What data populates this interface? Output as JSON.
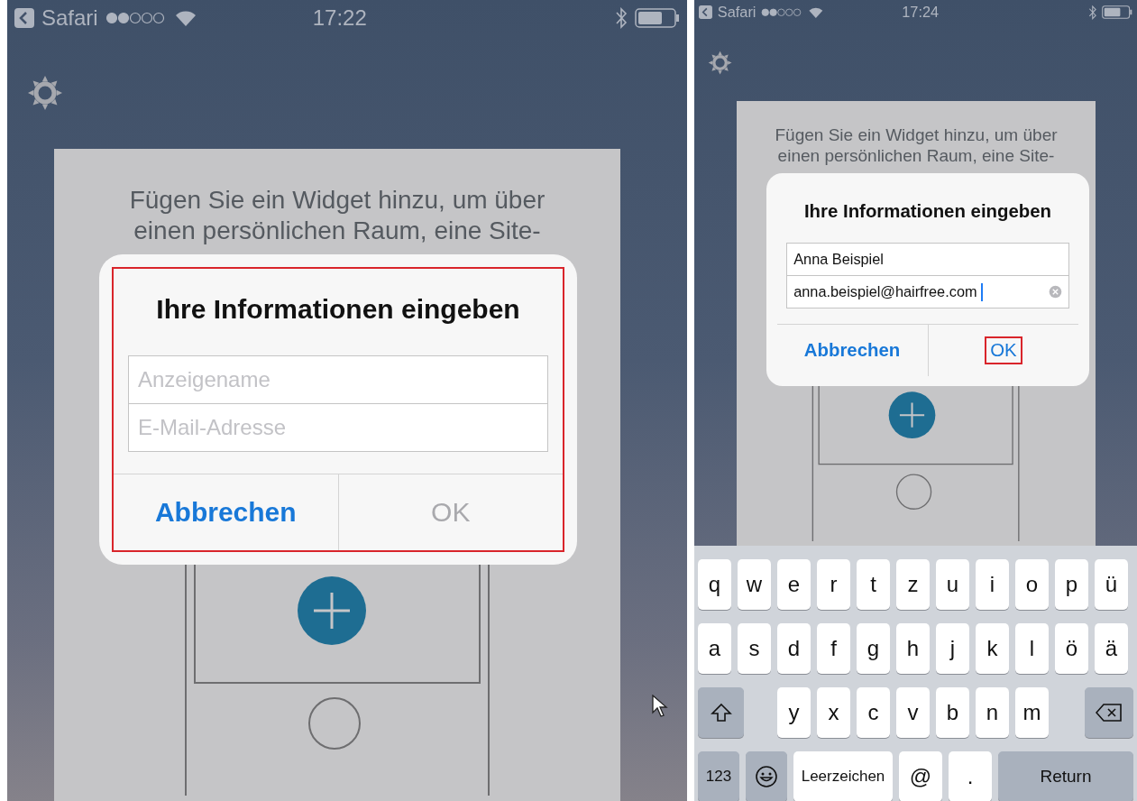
{
  "screens": [
    {
      "status_bar": {
        "back_label": "Safari",
        "time": "17:22"
      },
      "card_text_lines": [
        "Fügen Sie ein Widget hinzu, um über",
        "einen persönlichen Raum, eine Site-"
      ],
      "dialog": {
        "title": "Ihre Informationen eingeben",
        "highlighted": true,
        "fields": [
          {
            "placeholder": "Anzeigename",
            "focused": false
          },
          {
            "placeholder": "E-Mail-Adresse",
            "focused": false
          }
        ],
        "buttons": [
          {
            "label": "Abbrechen",
            "disabled": false,
            "highlighted": false
          },
          {
            "label": "OK",
            "disabled": true,
            "highlighted": false
          }
        ]
      }
    },
    {
      "status_bar": {
        "back_label": "Safari",
        "time": "17:24"
      },
      "card_text_lines": [
        "Fügen Sie ein Widget hinzu, um über",
        "einen persönlichen Raum, eine Site-"
      ],
      "dialog": {
        "title": "Ihre Informationen eingeben",
        "highlighted": false,
        "fields": [
          {
            "value": "Anna Beispiel",
            "focused": false
          },
          {
            "value": "anna.beispiel@hairfree.com",
            "focused": true
          }
        ],
        "buttons": [
          {
            "label": "Abbrechen",
            "disabled": false,
            "highlighted": false
          },
          {
            "label": "OK",
            "disabled": false,
            "highlighted": true
          }
        ]
      },
      "keyboard": {
        "rows": [
          [
            {
              "kind": "char",
              "label": "q"
            },
            {
              "kind": "char",
              "label": "w"
            },
            {
              "kind": "char",
              "label": "e"
            },
            {
              "kind": "char",
              "label": "r"
            },
            {
              "kind": "char",
              "label": "t"
            },
            {
              "kind": "char",
              "label": "z"
            },
            {
              "kind": "char",
              "label": "u"
            },
            {
              "kind": "char",
              "label": "i"
            },
            {
              "kind": "char",
              "label": "o"
            },
            {
              "kind": "char",
              "label": "p"
            },
            {
              "kind": "char",
              "label": "ü"
            }
          ],
          [
            {
              "kind": "char",
              "label": "a"
            },
            {
              "kind": "char",
              "label": "s"
            },
            {
              "kind": "char",
              "label": "d"
            },
            {
              "kind": "char",
              "label": "f"
            },
            {
              "kind": "char",
              "label": "g"
            },
            {
              "kind": "char",
              "label": "h"
            },
            {
              "kind": "char",
              "label": "j"
            },
            {
              "kind": "char",
              "label": "k"
            },
            {
              "kind": "char",
              "label": "l"
            },
            {
              "kind": "char",
              "label": "ö"
            },
            {
              "kind": "char",
              "label": "ä"
            }
          ],
          [
            {
              "kind": "shift"
            },
            {
              "kind": "gap"
            },
            {
              "kind": "char",
              "label": "y"
            },
            {
              "kind": "char",
              "label": "x"
            },
            {
              "kind": "char",
              "label": "c"
            },
            {
              "kind": "char",
              "label": "v"
            },
            {
              "kind": "char",
              "label": "b"
            },
            {
              "kind": "char",
              "label": "n"
            },
            {
              "kind": "char",
              "label": "m"
            },
            {
              "kind": "backspace"
            }
          ]
        ],
        "bottom_row": [
          {
            "kind": "function",
            "label": "123"
          },
          {
            "kind": "emoji"
          },
          {
            "kind": "space",
            "label": "Leerzeichen"
          },
          {
            "kind": "char",
            "label": "@"
          },
          {
            "kind": "char",
            "label": "."
          },
          {
            "kind": "return",
            "label": "Return"
          }
        ]
      }
    }
  ]
}
